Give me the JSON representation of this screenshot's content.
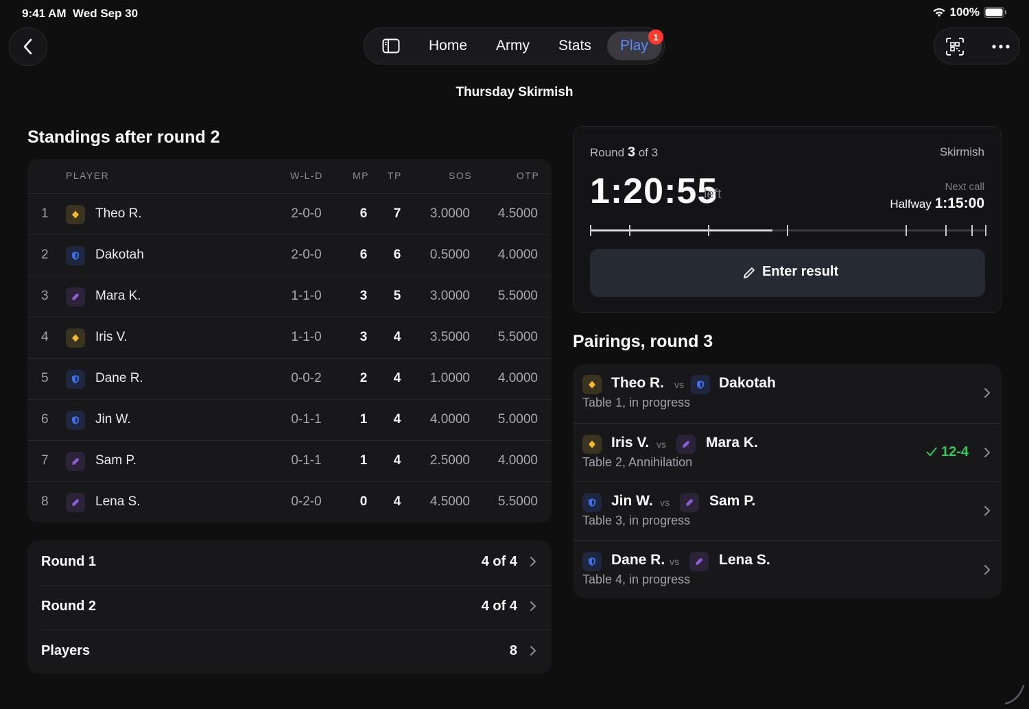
{
  "status_bar": {
    "time": "9:41 AM",
    "date": "Wed Sep 30",
    "battery": "100%"
  },
  "nav": {
    "tabs": [
      {
        "label": "Home"
      },
      {
        "label": "Army"
      },
      {
        "label": "Stats"
      },
      {
        "label": "Play",
        "badge": "1",
        "active": true
      }
    ]
  },
  "event": {
    "title": "Thursday Skirmish"
  },
  "standings": {
    "title": "Standings after round 2",
    "headers": {
      "player": "PLAYER",
      "wld": "W-L-D",
      "mp": "MP",
      "tp": "TP",
      "sos": "SOS",
      "otp": "OTP"
    },
    "rows": [
      {
        "rank": "1",
        "name": "Theo R.",
        "faction": "gold",
        "wld": "2-0-0",
        "mp": "6",
        "tp": "7",
        "sos": "3.0000",
        "otp": "4.5000"
      },
      {
        "rank": "2",
        "name": "Dakotah",
        "faction": "blue",
        "wld": "2-0-0",
        "mp": "6",
        "tp": "6",
        "sos": "0.5000",
        "otp": "4.0000"
      },
      {
        "rank": "3",
        "name": "Mara K.",
        "faction": "purple",
        "wld": "1-1-0",
        "mp": "3",
        "tp": "5",
        "sos": "3.0000",
        "otp": "5.5000"
      },
      {
        "rank": "4",
        "name": "Iris V.",
        "faction": "gold",
        "wld": "1-1-0",
        "mp": "3",
        "tp": "4",
        "sos": "3.5000",
        "otp": "5.5000"
      },
      {
        "rank": "5",
        "name": "Dane R.",
        "faction": "blue",
        "wld": "0-0-2",
        "mp": "2",
        "tp": "4",
        "sos": "1.0000",
        "otp": "4.0000"
      },
      {
        "rank": "6",
        "name": "Jin W.",
        "faction": "blue",
        "wld": "0-1-1",
        "mp": "1",
        "tp": "4",
        "sos": "4.0000",
        "otp": "5.0000"
      },
      {
        "rank": "7",
        "name": "Sam P.",
        "faction": "purple",
        "wld": "0-1-1",
        "mp": "1",
        "tp": "4",
        "sos": "2.5000",
        "otp": "4.0000"
      },
      {
        "rank": "8",
        "name": "Lena S.",
        "faction": "purple",
        "wld": "0-2-0",
        "mp": "0",
        "tp": "4",
        "sos": "4.5000",
        "otp": "5.5000"
      }
    ]
  },
  "rounds": [
    {
      "label": "Round 1",
      "value": "4 of 4"
    },
    {
      "label": "Round 2",
      "value": "4 of 4"
    },
    {
      "label": "Players",
      "value": "8"
    }
  ],
  "timer": {
    "round_prefix": "Round",
    "round_current": "3",
    "round_suffix": "of 3",
    "mode": "Skirmish",
    "time_left": "1:20:55",
    "left_label": "left",
    "next_call_label": "Next call",
    "next_call_name": "Halfway",
    "next_call_time": "1:15:00",
    "progress": 0.46,
    "enter_result_label": "Enter result"
  },
  "pairings": {
    "title": "Pairings, round 3",
    "vs_label": "vs",
    "rows": [
      {
        "p1": "Theo R.",
        "p1_faction": "gold",
        "p2": "Dakotah",
        "p2_faction": "blue",
        "sub": "Table 1, in progress",
        "result": ""
      },
      {
        "p1": "Iris V.",
        "p1_faction": "gold",
        "p2": "Mara K.",
        "p2_faction": "purple",
        "sub": "Table 2, Annihilation",
        "result": "12-4"
      },
      {
        "p1": "Jin W.",
        "p1_faction": "blue",
        "p2": "Sam P.",
        "p2_faction": "purple",
        "sub": "Table 3, in progress",
        "result": ""
      },
      {
        "p1": "Dane R.",
        "p1_faction": "blue",
        "p2": "Lena S.",
        "p2_faction": "purple",
        "sub": "Table 4, in progress",
        "result": ""
      }
    ]
  },
  "colors": {
    "accent": "#5e8cff",
    "success": "#34c759",
    "badge": "#ff3b30",
    "gold": "#f5b82e",
    "blue": "#3f6fe8",
    "purple": "#8a5cd6"
  }
}
